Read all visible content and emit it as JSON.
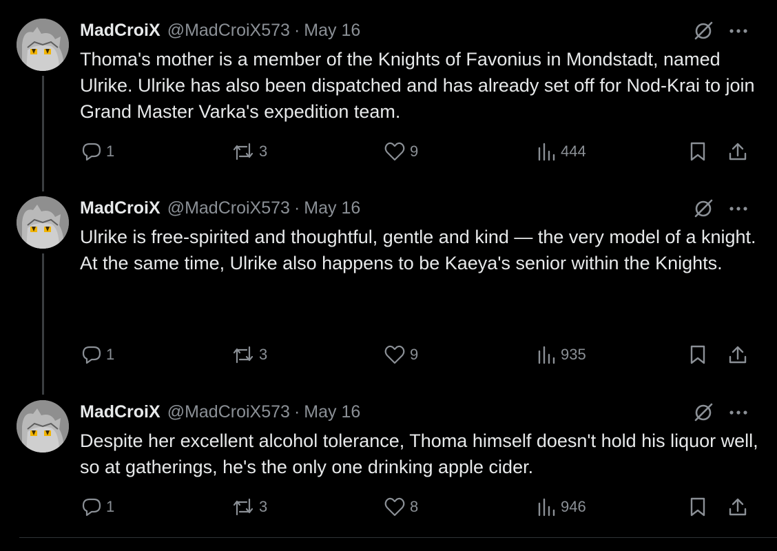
{
  "tweets": [
    {
      "author": "MadCroiX",
      "handle": "@MadCroiX573",
      "separator": "·",
      "date": "May 16",
      "lines": [
        "Thoma's mother is a member of the Knights of Favonius in Mondstadt, named Ulrike. Ulrike has also been dispatched and has already set off for Nod-Krai to join Grand Master Varka's expedition team."
      ],
      "replies": "1",
      "reposts": "3",
      "likes": "9",
      "views": "444"
    },
    {
      "author": "MadCroiX",
      "handle": "@MadCroiX573",
      "separator": "·",
      "date": "May 16",
      "lines": [
        "Ulrike is free-spirited and thoughtful, gentle and kind — the very model of a knight.",
        "At the same time, Ulrike also happens to be Kaeya's senior within the Knights."
      ],
      "replies": "1",
      "reposts": "3",
      "likes": "9",
      "views": "935"
    },
    {
      "author": "MadCroiX",
      "handle": "@MadCroiX573",
      "separator": "·",
      "date": "May 16",
      "lines": [
        "Despite her excellent alcohol tolerance, Thoma himself doesn't hold his liquor well, so at gatherings, he's the only one drinking apple cider."
      ],
      "replies": "1",
      "reposts": "3",
      "likes": "8",
      "views": "946"
    }
  ],
  "icons": {
    "avatar": "cat-avatar-icon",
    "grok": "grok-icon",
    "more": "more-icon",
    "reply": "reply-icon",
    "repost": "repost-icon",
    "like": "heart-icon",
    "views": "views-icon",
    "bookmark": "bookmark-icon",
    "share": "share-icon"
  },
  "colors": {
    "background": "#000000",
    "text": "#e7e9ea",
    "muted": "#8b9096",
    "thread_line": "#3a3d40"
  }
}
